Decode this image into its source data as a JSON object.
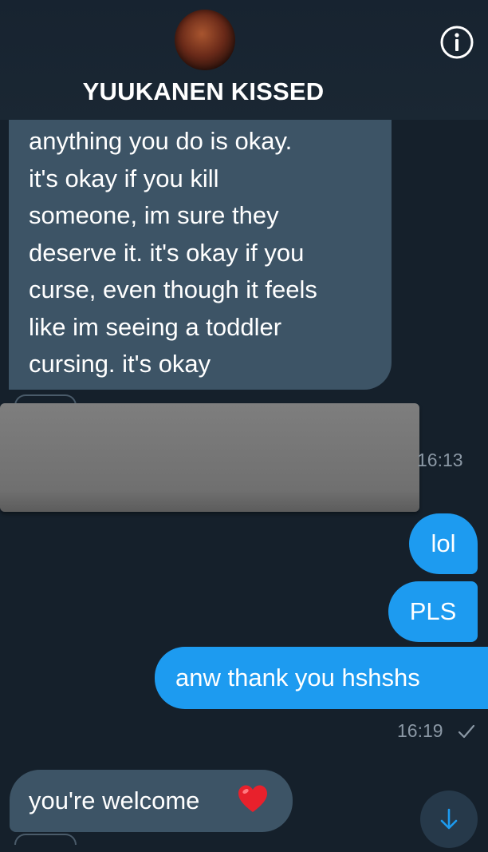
{
  "header": {
    "title": "YUUKANEN KISSED",
    "avatar_icon": "profile-avatar",
    "info_icon": "info-icon"
  },
  "messages": {
    "received_1_lines": [
      "anything you do is okay.",
      "it's okay if you kill",
      "someone, im sure they",
      "deserve it. it's okay if you",
      "curse, even though it feels",
      "like im seeing a toddler",
      "cursing. it's okay"
    ],
    "time_1": "16:13",
    "sent_1": "lol",
    "sent_2": "PLS",
    "sent_3": "anw thank you hshshs",
    "time_2": "16:19",
    "received_2": "you're welcome",
    "received_2_emoji": "heart-emoji"
  },
  "colors": {
    "background": "#15202b",
    "received_bubble": "#3d5466",
    "sent_bubble": "#1d9bf0",
    "timestamp": "#8b98a5"
  },
  "controls": {
    "scroll_down_icon": "arrow-down-icon"
  }
}
